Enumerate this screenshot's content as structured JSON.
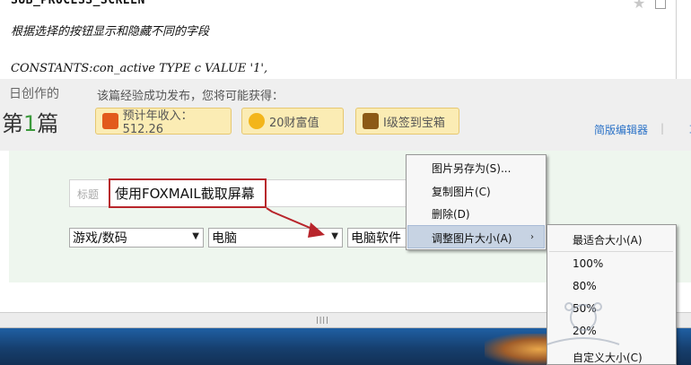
{
  "editor": {
    "window_title": "SUB_PROCESS_SCREEN",
    "comment_line": "根据选择的按钮显示和隐藏不同的字段",
    "code_line": "CONSTANTS:con_active TYPE c VALUE '1',"
  },
  "stats": {
    "caption": "日创作的",
    "count_prefix": "第",
    "count_number": "1",
    "count_suffix": "篇"
  },
  "publish": {
    "heading": "该篇经验成功发布，您将可能获得：",
    "rewards": [
      {
        "label": "预计年收入：512.26",
        "icon": "red-envelope-icon"
      },
      {
        "label": "20财富值",
        "icon": "gold-coin-icon"
      },
      {
        "label": "Ⅰ级签到宝箱",
        "icon": "treasure-chest-icon"
      }
    ],
    "simple_editor": "简版编辑器",
    "separator": "|",
    "cut_link": "草"
  },
  "form": {
    "title_label": "标题",
    "title_value": "使用FOXMAIL截取屏幕",
    "categories": [
      "游戏/数码",
      "电脑",
      "电脑软件"
    ]
  },
  "context_menu": {
    "items": [
      "图片另存为(S)...",
      "复制图片(C)",
      "删除(D)",
      "调整图片大小(A)"
    ],
    "submenu_arrow": "›",
    "highlighted_index": 3
  },
  "resize_submenu": {
    "items": [
      "最适合大小(A)",
      "100%",
      "80%",
      "50%",
      "20%",
      "自定义大小(C)"
    ]
  },
  "colors": {
    "highlight_border": "#b8252b",
    "menu_highlight": "#c7d3e3",
    "link_blue": "#2b72c7",
    "reward_bg": "#fbecb4"
  }
}
